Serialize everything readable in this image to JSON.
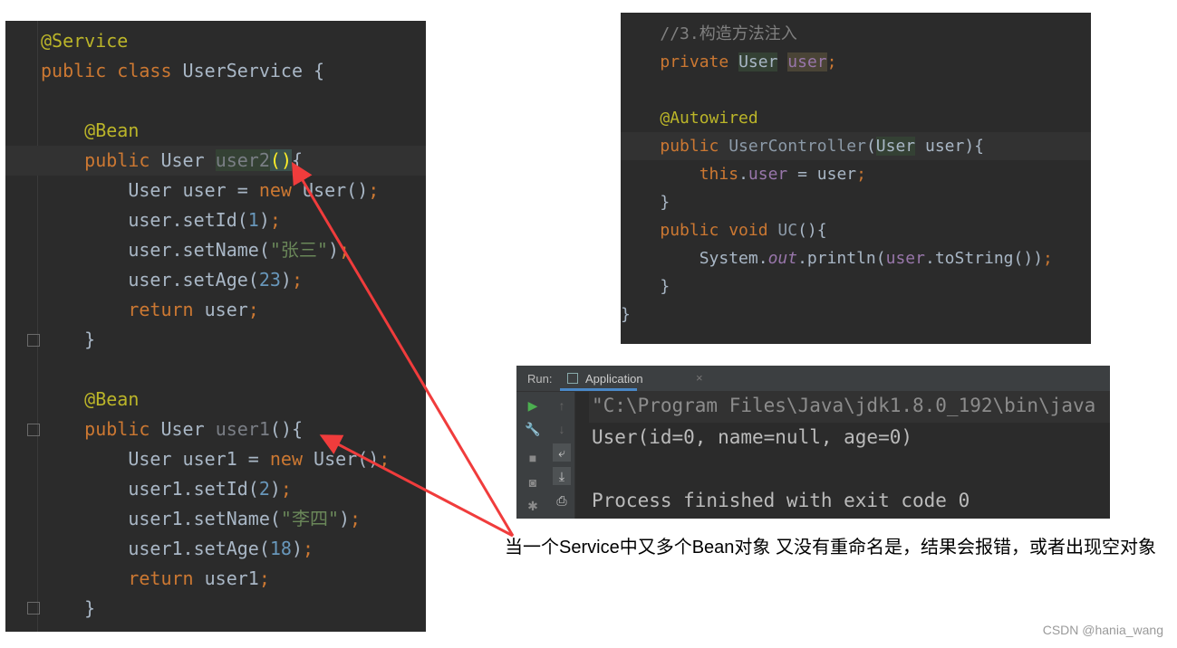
{
  "left_code": [
    [
      [
        "@Service",
        "a"
      ]
    ],
    [
      [
        "public class ",
        "k"
      ],
      [
        "UserService {",
        "t"
      ]
    ],
    [],
    [
      [
        "    "
      ],
      [
        "@Bean",
        "a"
      ]
    ],
    [
      [
        "    "
      ],
      [
        "public ",
        "k"
      ],
      [
        "User ",
        "t"
      ],
      [
        "user2",
        "gb"
      ],
      [
        "()",
        "y"
      ],
      [
        "{",
        "t"
      ]
    ],
    [
      [
        "        "
      ],
      [
        "User user = ",
        "t"
      ],
      [
        "new ",
        "k"
      ],
      [
        "User()",
        "t"
      ],
      [
        ";",
        "k"
      ]
    ],
    [
      [
        "        "
      ],
      [
        "user.setId(",
        "t"
      ],
      [
        "1",
        "n"
      ],
      [
        ")",
        "t"
      ],
      [
        ";",
        "k"
      ]
    ],
    [
      [
        "        "
      ],
      [
        "user.setName(",
        "t"
      ],
      [
        "\"张三\"",
        "s"
      ],
      [
        ")",
        "t"
      ],
      [
        ";",
        "k"
      ]
    ],
    [
      [
        "        "
      ],
      [
        "user.setAge(",
        "t"
      ],
      [
        "23",
        "n"
      ],
      [
        ")",
        "t"
      ],
      [
        ";",
        "k"
      ]
    ],
    [
      [
        "        "
      ],
      [
        "return ",
        "k"
      ],
      [
        "user",
        "t"
      ],
      [
        ";",
        "k"
      ]
    ],
    [
      [
        "    "
      ],
      [
        "}",
        "t"
      ]
    ],
    [],
    [
      [
        "    "
      ],
      [
        "@Bean",
        "a"
      ]
    ],
    [
      [
        "    "
      ],
      [
        "public ",
        "k"
      ],
      [
        "User ",
        "t"
      ],
      [
        "user1",
        "g"
      ],
      [
        "(){",
        "t"
      ]
    ],
    [
      [
        "        "
      ],
      [
        "User user1 = ",
        "t"
      ],
      [
        "new ",
        "k"
      ],
      [
        "User()",
        "t"
      ],
      [
        ";",
        "k"
      ]
    ],
    [
      [
        "        "
      ],
      [
        "user1.setId(",
        "t"
      ],
      [
        "2",
        "n"
      ],
      [
        ")",
        "t"
      ],
      [
        ";",
        "k"
      ]
    ],
    [
      [
        "        "
      ],
      [
        "user1.setName(",
        "t"
      ],
      [
        "\"李四\"",
        "s"
      ],
      [
        ")",
        "t"
      ],
      [
        ";",
        "k"
      ]
    ],
    [
      [
        "        "
      ],
      [
        "user1.setAge(",
        "t"
      ],
      [
        "18",
        "n"
      ],
      [
        ")",
        "t"
      ],
      [
        ";",
        "k"
      ]
    ],
    [
      [
        "        "
      ],
      [
        "return ",
        "k"
      ],
      [
        "user1",
        "t"
      ],
      [
        ";",
        "k"
      ]
    ],
    [
      [
        "    "
      ],
      [
        "}",
        "t"
      ]
    ]
  ],
  "right_code": [
    [
      [
        "    "
      ],
      [
        "//3.构造方法注入",
        "c"
      ]
    ],
    [
      [
        "    "
      ],
      [
        "private ",
        "k"
      ],
      [
        "User",
        "tb"
      ],
      [
        " ",
        "t"
      ],
      [
        "user",
        "fb"
      ],
      [
        ";",
        "k"
      ]
    ],
    [],
    [
      [
        "    "
      ],
      [
        "@Autowired",
        "a"
      ]
    ],
    [
      [
        "    "
      ],
      [
        "public ",
        "k"
      ],
      [
        "UserController",
        "gm"
      ],
      [
        "(",
        "t"
      ],
      [
        "User",
        "tb"
      ],
      [
        " user){",
        "t"
      ]
    ],
    [
      [
        "        "
      ],
      [
        "this",
        "k"
      ],
      [
        ".",
        "t"
      ],
      [
        "user",
        "f"
      ],
      [
        " = user",
        "t"
      ],
      [
        ";",
        "k"
      ]
    ],
    [
      [
        "    "
      ],
      [
        "}",
        "t"
      ]
    ],
    [
      [
        "    "
      ],
      [
        "public void ",
        "k"
      ],
      [
        "UC",
        "gm"
      ],
      [
        "(){",
        "t"
      ]
    ],
    [
      [
        "        "
      ],
      [
        "System.",
        "t"
      ],
      [
        "out",
        "i"
      ],
      [
        ".println(",
        "t"
      ],
      [
        "user",
        "f"
      ],
      [
        ".toString())",
        "t"
      ],
      [
        ";",
        "k"
      ]
    ],
    [
      [
        "    "
      ],
      [
        "}",
        "t"
      ]
    ],
    [
      [
        "}",
        "t"
      ]
    ]
  ],
  "run_panel": {
    "run_label": "Run:",
    "tab_label": "Application",
    "tab_close": "×",
    "console": [
      "\"C:\\Program Files\\Java\\jdk1.8.0_192\\bin\\java",
      "User(id=0, name=null, age=0)",
      "",
      "Process finished with exit code 0"
    ]
  },
  "caption": "当一个Service中又多个Bean对象 又没有重命名是，结果会报错，或者出现空对象",
  "watermark": "CSDN @hania_wang",
  "colors": {
    "editor_bg": "#2b2b2b",
    "keyword": "#cc7832",
    "annotation": "#bbb529",
    "arrow": "#f03c3c"
  }
}
